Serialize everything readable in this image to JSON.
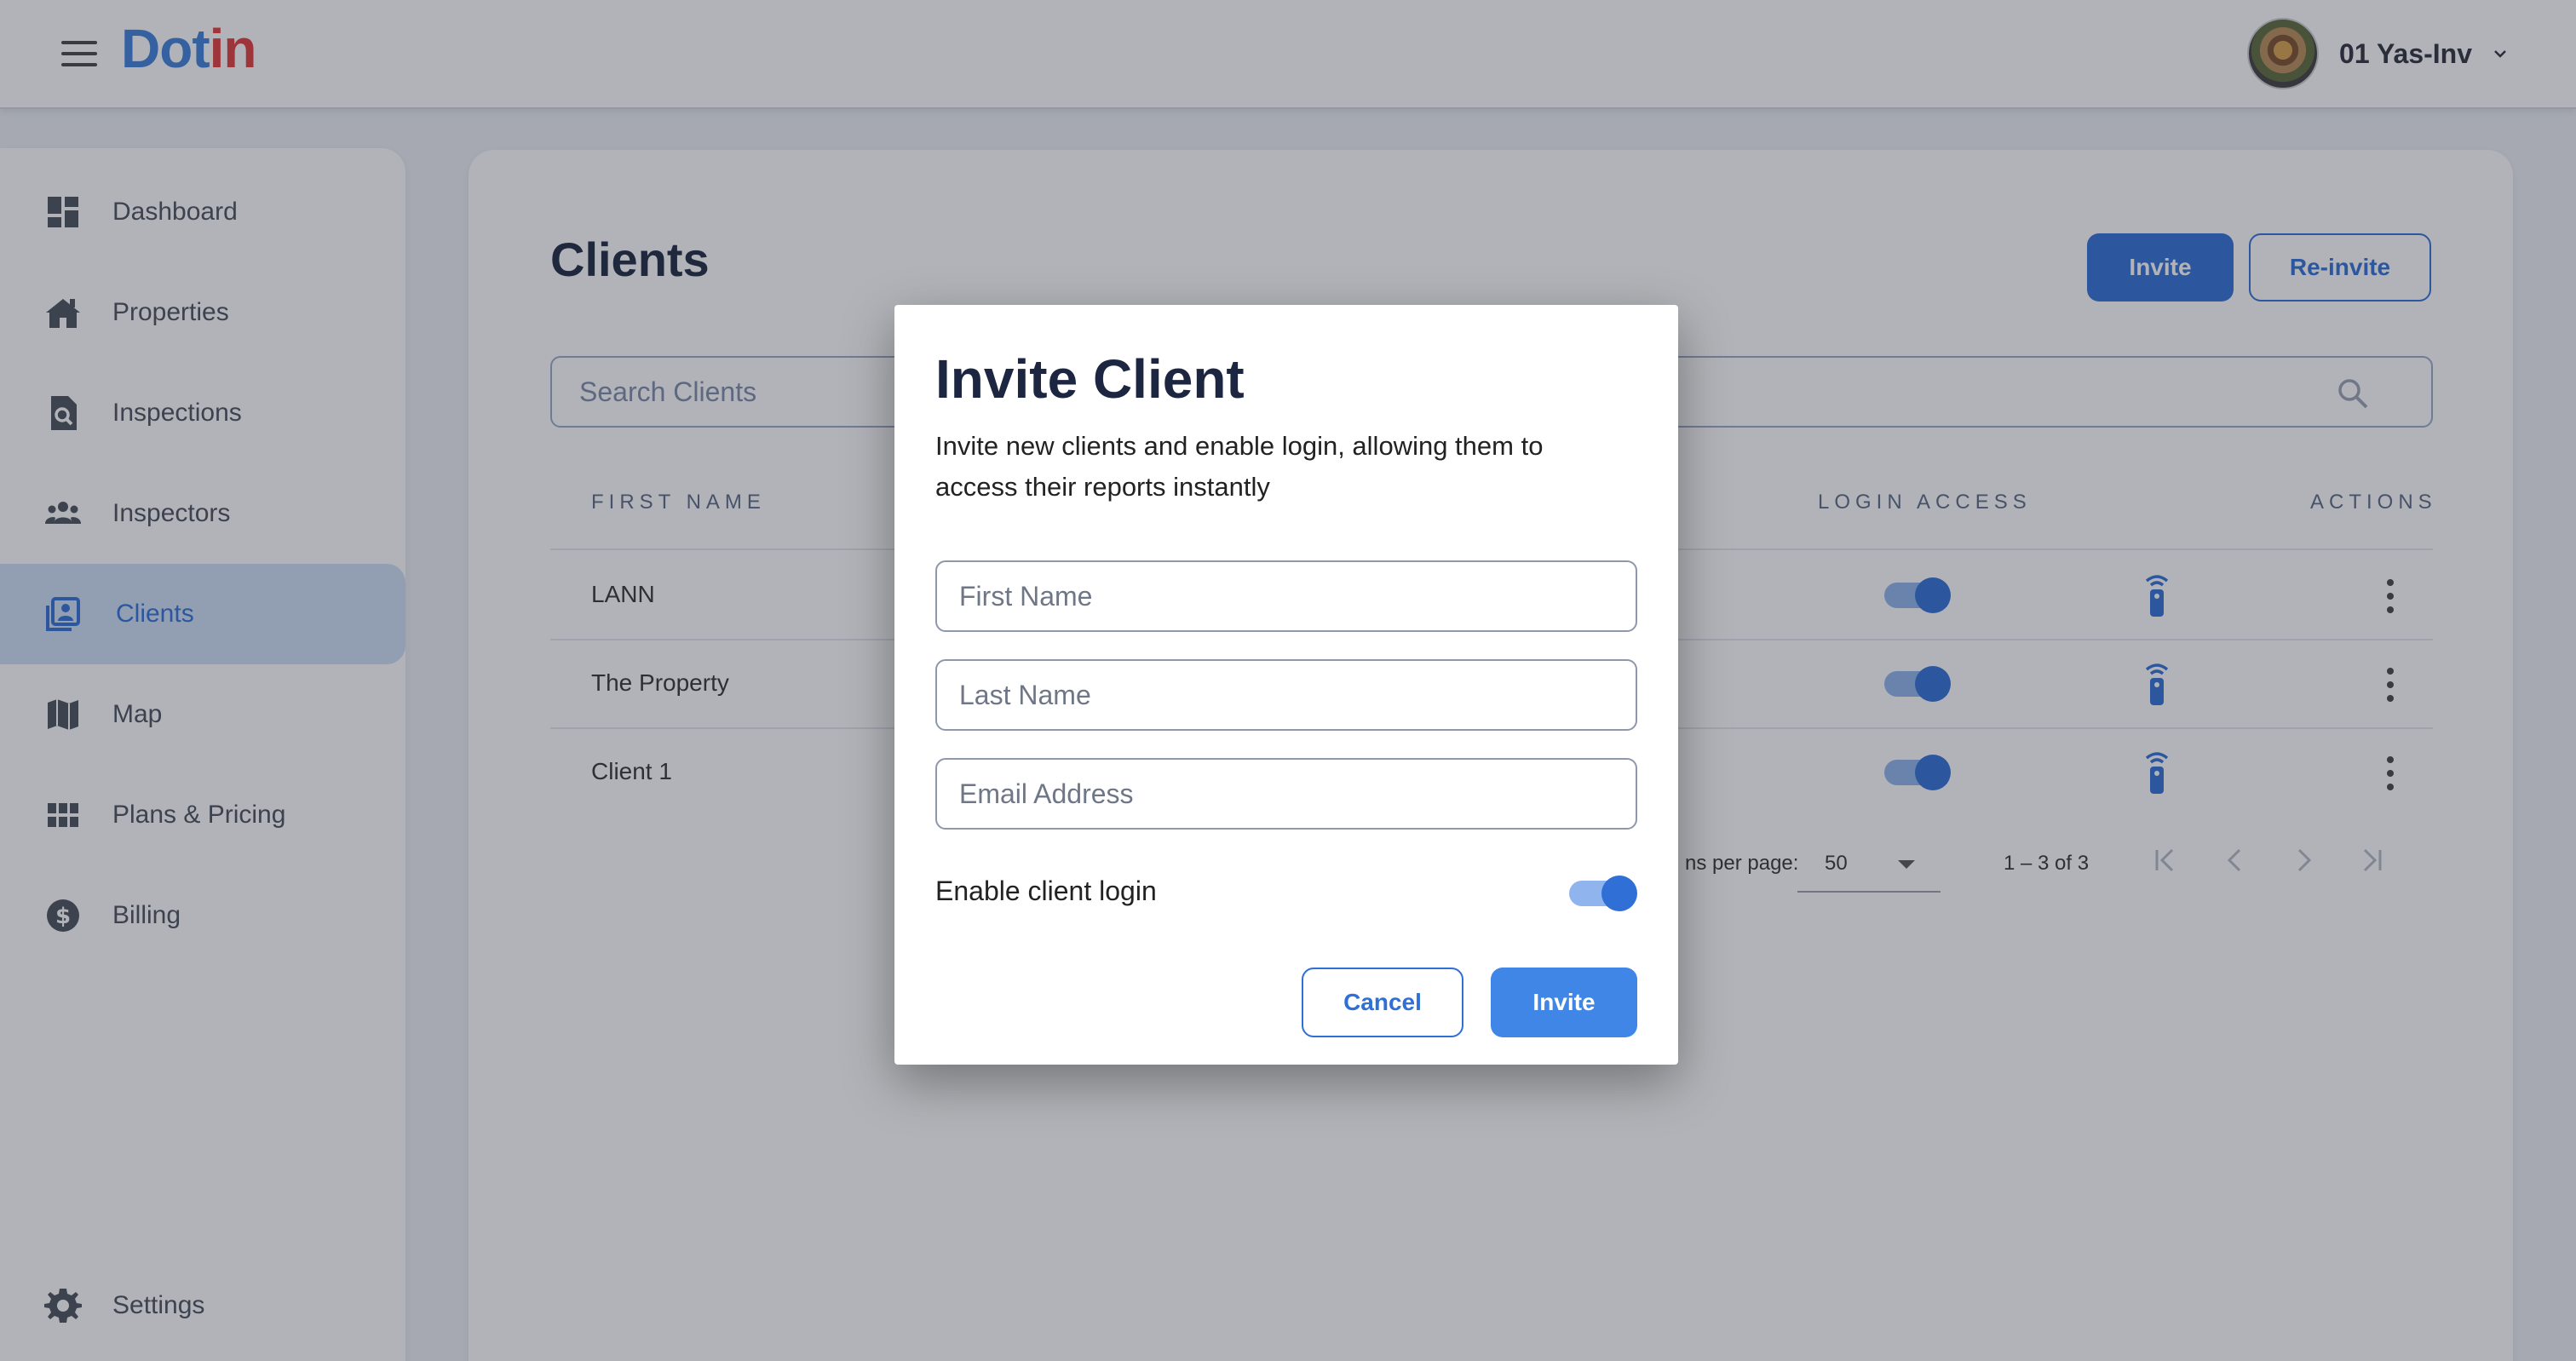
{
  "header": {
    "logo_part1": "Dot",
    "logo_part2": "in",
    "username": "01 Yas-Inv"
  },
  "sidebar": {
    "items": [
      {
        "label": "Dashboard",
        "icon": "dashboard-icon"
      },
      {
        "label": "Properties",
        "icon": "home-icon"
      },
      {
        "label": "Inspections",
        "icon": "inspection-search-icon"
      },
      {
        "label": "Inspectors",
        "icon": "people-icon"
      },
      {
        "label": "Clients",
        "icon": "client-card-icon",
        "active": true
      },
      {
        "label": "Map",
        "icon": "map-icon"
      },
      {
        "label": "Plans & Pricing",
        "icon": "grid-icon"
      },
      {
        "label": "Billing",
        "icon": "dollar-icon"
      }
    ],
    "settings_label": "Settings"
  },
  "main": {
    "title": "Clients",
    "invite_label": "Invite",
    "reinvite_label": "Re-invite",
    "search_placeholder": "Search Clients",
    "columns": {
      "first_name": "FIRST NAME",
      "login_access": "LOGIN ACCESS",
      "actions": "ACTIONS"
    },
    "rows": [
      {
        "first_name": "LANN",
        "login_access": true
      },
      {
        "first_name": "The Property",
        "login_access": true
      },
      {
        "first_name": "Client 1",
        "login_access": true
      }
    ],
    "pagination": {
      "items_per_page_label": "ns per page:",
      "items_per_page": "50",
      "range": "1 – 3 of 3"
    }
  },
  "modal": {
    "title": "Invite Client",
    "description": "Invite new clients and enable login, allowing them to access their reports instantly",
    "first_name_placeholder": "First Name",
    "last_name_placeholder": "Last Name",
    "email_placeholder": "Email Address",
    "enable_login_label": "Enable client login",
    "enable_login": true,
    "cancel_label": "Cancel",
    "invite_label": "Invite"
  },
  "colors": {
    "primary": "#2f6fd6",
    "logo_blue": "#3f7fdc",
    "logo_red": "#e23a3a",
    "active_bg": "#cfe0f7"
  }
}
